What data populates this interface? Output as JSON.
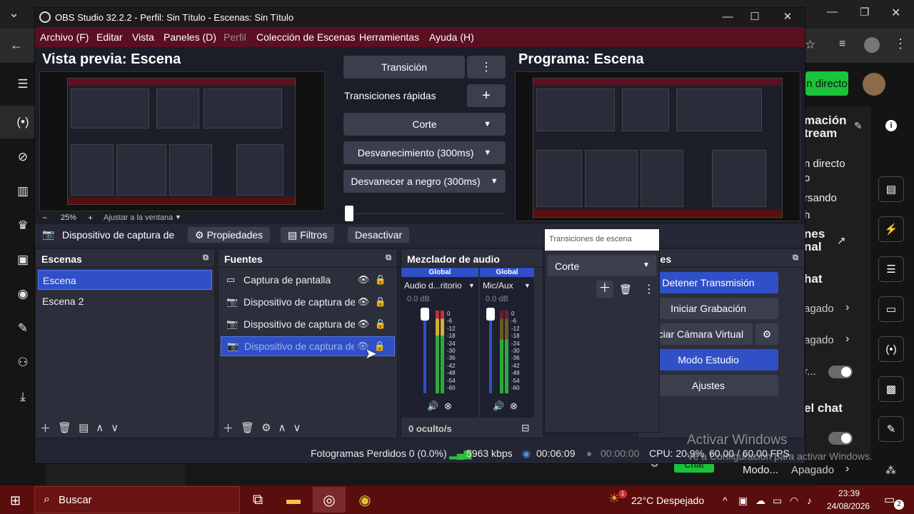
{
  "browser": {
    "live_button": "n directo",
    "right_panel": {
      "heading1_a": "mación",
      "heading1_b": "tream",
      "text_a": "n directo",
      "text_b": "o",
      "text_c": "rsando",
      "text_d": "h",
      "heading2_a": "nes",
      "heading2_b": "nal",
      "heading3": "hat",
      "row1": "agado",
      "row2": "agado",
      "row3": "r...",
      "heading4": "el chat",
      "bottom_left": "Modo...",
      "bottom_right": "Apagado",
      "chat_btn": "Chat"
    }
  },
  "obs": {
    "title": "OBS Studio 32.2.2 - Perfil: Sin Título - Escenas: Sin Título",
    "menu": [
      "Archivo (F)",
      "Editar",
      "Vista",
      "Paneles (D)",
      "Perfil",
      "Colección de Escenas",
      "Herramientas",
      "Ayuda (H)"
    ],
    "preview_title": "Vista previa: Escena",
    "program_title": "Programa: Escena",
    "zoom": {
      "minus": "−",
      "value": "25%",
      "plus": "+",
      "fit": "Ajustar a la ventana"
    },
    "transition": {
      "button": "Transición",
      "quick_label": "Transiciones rápidas",
      "items": [
        "Corte",
        "Desvanecimiento (300ms)",
        "Desvanecer a negro (300ms)"
      ]
    },
    "toolbar": {
      "source_name": "Dispositivo de captura de v",
      "properties": "Propiedades",
      "filters": "Filtros",
      "deactivate": "Desactivar"
    },
    "scenes": {
      "title": "Escenas",
      "items": [
        "Escena",
        "Escena 2"
      ]
    },
    "sources": {
      "title": "Fuentes",
      "items": [
        "Captura de pantalla",
        "Dispositivo de captura de v",
        "Dispositivo de captura de v",
        "Dispositivo de captura de v"
      ]
    },
    "mixer": {
      "title": "Mezclador de audio",
      "channels": [
        {
          "badge": "Global",
          "name": "Audio d...ritorio",
          "db": "0.0 dB"
        },
        {
          "badge": "Global",
          "name": "Mic/Aux",
          "db": "0.0 dB"
        }
      ],
      "scale": [
        "0",
        "-6",
        "-12",
        "-18",
        "-24",
        "-30",
        "-36",
        "-42",
        "-48",
        "-54",
        "-60"
      ],
      "footer": "0 oculto/s"
    },
    "popup": {
      "input_value": "Transiciones de escena",
      "select": "Corte"
    },
    "controls": {
      "title": "troles",
      "stop_stream": "Detener Transmisión",
      "start_rec": "Iniciar Grabación",
      "virtual_cam": "Iniciar Cámara Virtual",
      "studio_mode": "Modo Estudio",
      "settings": "Ajustes"
    },
    "status": {
      "dropped": "Fotogramas Perdidos 0 (0.0%)",
      "kbps": "5963 kbps",
      "stream_time": "00:06:09",
      "rec_time": "00:00:00",
      "cpu": "CPU: 20.9%",
      "fps": "60.00 / 60.00 FPS"
    }
  },
  "watermark": {
    "line1": "Activar Windows",
    "line2": "Ve a Configuración para activar Windows."
  },
  "taskbar": {
    "search": "Buscar",
    "weather": "22°C  Despejado",
    "time": "23:39",
    "date": "24/08/2026",
    "notif_count": "2",
    "weather_badge": "1"
  },
  "colors": {
    "menubar": "#5a1021",
    "accent": "#3050c8",
    "taskbar": "#5a0d0d"
  }
}
